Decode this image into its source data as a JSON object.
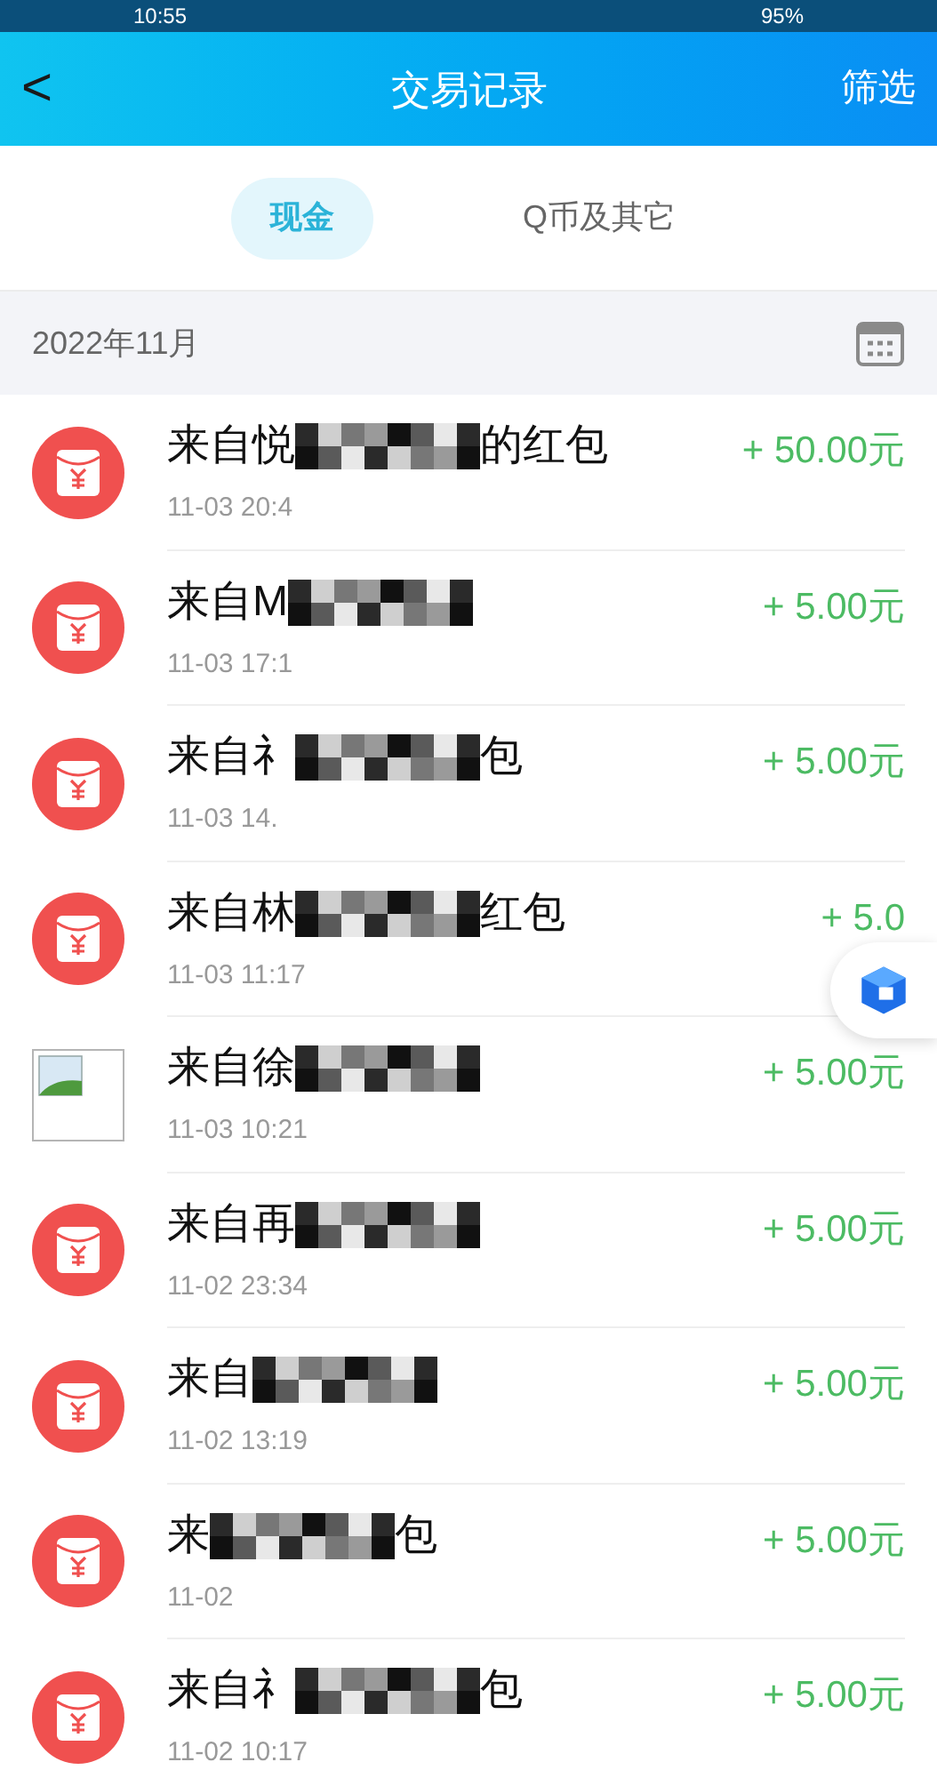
{
  "status_bar": {
    "time": "10:55",
    "battery": "95%"
  },
  "nav": {
    "back": "<",
    "title": "交易记录",
    "action": "筛选"
  },
  "tabs": [
    {
      "label": "现金",
      "selected": true
    },
    {
      "label": "Q币及其它",
      "selected": false
    }
  ],
  "month": {
    "label": "2022年11月"
  },
  "transactions": [
    {
      "kind": "red_packet",
      "title_start": "来自悦",
      "title_end": "的红包",
      "time": "11-03 20:4",
      "amount": "+ 50.00元"
    },
    {
      "kind": "red_packet",
      "title_start": "来自M",
      "time": "11-03 17:1",
      "amount": "+ 5.00元"
    },
    {
      "kind": "red_packet",
      "title_start": "来自礻",
      "title_end": "包",
      "time": "11-03 14.",
      "amount": "+ 5.00元"
    },
    {
      "kind": "red_packet",
      "title_start": "来自林",
      "title_end": "红包",
      "time": "11-03 11:17",
      "amount": "+ 5.0"
    },
    {
      "kind": "broken_image",
      "title_start": "来自徐",
      "time": "11-03 10:21",
      "amount": "+ 5.00元"
    },
    {
      "kind": "red_packet",
      "title_start": "来自再",
      "time": "11-02 23:34",
      "amount": "+ 5.00元"
    },
    {
      "kind": "red_packet",
      "title_start": "来自",
      "time": "11-02 13:19",
      "amount": "+ 5.00元"
    },
    {
      "kind": "red_packet",
      "title_start": "来",
      "title_end": "包",
      "time": "11-02",
      "amount": "+ 5.00元"
    },
    {
      "kind": "red_packet",
      "title_start": "来自礻",
      "title_end": "包",
      "time": "11-02 10:17",
      "amount": "+ 5.00元"
    }
  ]
}
